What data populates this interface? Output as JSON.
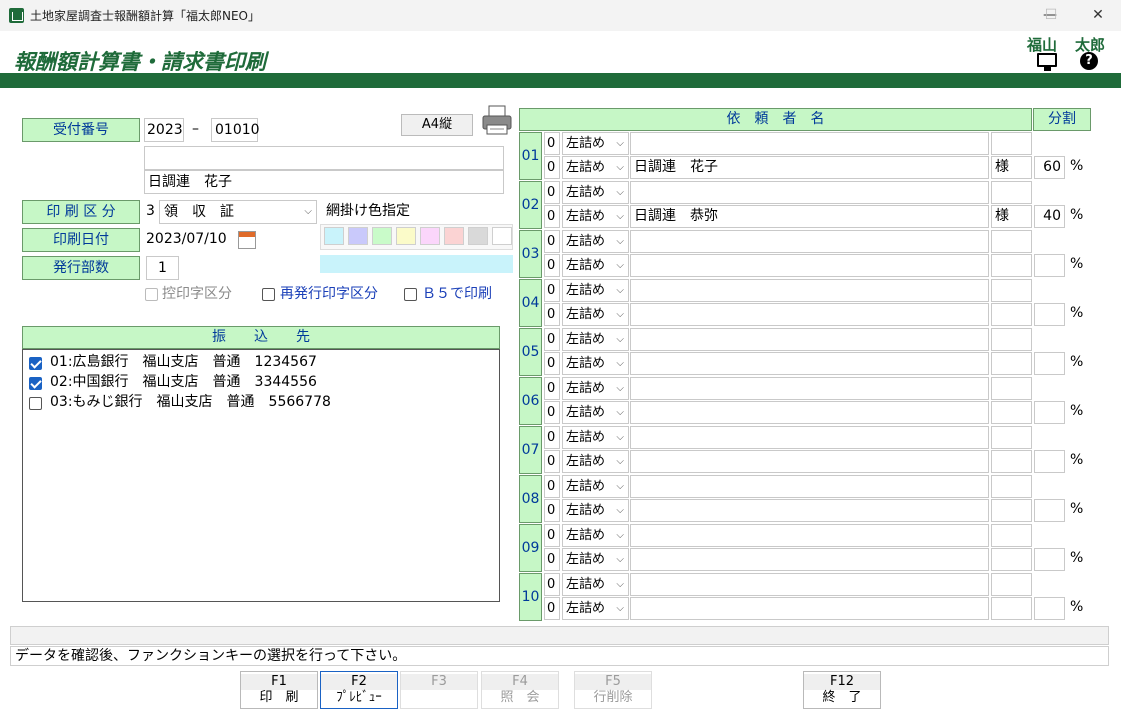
{
  "window": {
    "title": "土地家屋調査士報酬額計算「福太郎NEO」",
    "min": "—",
    "max": "☐",
    "close": "✕"
  },
  "header": {
    "title": "報酬額計算書・請求書印刷",
    "user_last": "福山",
    "user_first": "太郎",
    "help": "?"
  },
  "form": {
    "uketsuke_label": "受付番号",
    "uketsuke_year": "2023",
    "uketsuke_dash": "–",
    "uketsuke_no": "01010",
    "paper_size": "A4縦",
    "client_blank": "",
    "client_name": "日調連　花子",
    "print_kubun_label": "印 刷 区 分",
    "print_kubun_code": "3",
    "print_kubun_value": "領　収　証",
    "amikake_label": "網掛け色指定",
    "print_date_label": "印刷日付",
    "print_date": "2023/07/10",
    "copies_label": "発行部数",
    "copies": "1",
    "cb_hikae": "控印字区分",
    "cb_saihakko": "再発行印字区分",
    "cb_b5": "Ｂ５で印刷"
  },
  "swatch_colors": [
    "#c9f3fb",
    "#c9c9fb",
    "#c9fbc9",
    "#fbfbc9",
    "#fbd6fb",
    "#fbd3d3",
    "#d9d9d9",
    "#ffffff"
  ],
  "furikomi": {
    "header": "振　　込　　先",
    "items": [
      {
        "text": "01:広島銀行　福山支店　普通　1234567",
        "checked": true
      },
      {
        "text": "02:中国銀行　福山支店　普通　3344556",
        "checked": true
      },
      {
        "text": "03:もみじ銀行　福山支店　普通　5566778",
        "checked": false
      }
    ]
  },
  "grid": {
    "header_name": "依　頼　者　名",
    "header_split": "分割",
    "justify": "左詰め",
    "pct": "%",
    "rows": [
      {
        "no": "01",
        "a": {
          "code": "0",
          "name": "",
          "sama": "",
          "split": ""
        },
        "b": {
          "code": "0",
          "name": "日調連　花子",
          "sama": "様",
          "split": "60"
        }
      },
      {
        "no": "02",
        "a": {
          "code": "0",
          "name": "",
          "sama": "",
          "split": ""
        },
        "b": {
          "code": "0",
          "name": "日調連　恭弥",
          "sama": "様",
          "split": "40"
        }
      },
      {
        "no": "03",
        "a": {
          "code": "0",
          "name": "",
          "sama": "",
          "split": ""
        },
        "b": {
          "code": "0",
          "name": "",
          "sama": "",
          "split": ""
        }
      },
      {
        "no": "04",
        "a": {
          "code": "0",
          "name": "",
          "sama": "",
          "split": ""
        },
        "b": {
          "code": "0",
          "name": "",
          "sama": "",
          "split": ""
        }
      },
      {
        "no": "05",
        "a": {
          "code": "0",
          "name": "",
          "sama": "",
          "split": ""
        },
        "b": {
          "code": "0",
          "name": "",
          "sama": "",
          "split": ""
        }
      },
      {
        "no": "06",
        "a": {
          "code": "0",
          "name": "",
          "sama": "",
          "split": ""
        },
        "b": {
          "code": "0",
          "name": "",
          "sama": "",
          "split": ""
        }
      },
      {
        "no": "07",
        "a": {
          "code": "0",
          "name": "",
          "sama": "",
          "split": ""
        },
        "b": {
          "code": "0",
          "name": "",
          "sama": "",
          "split": ""
        }
      },
      {
        "no": "08",
        "a": {
          "code": "0",
          "name": "",
          "sama": "",
          "split": ""
        },
        "b": {
          "code": "0",
          "name": "",
          "sama": "",
          "split": ""
        }
      },
      {
        "no": "09",
        "a": {
          "code": "0",
          "name": "",
          "sama": "",
          "split": ""
        },
        "b": {
          "code": "0",
          "name": "",
          "sama": "",
          "split": ""
        }
      },
      {
        "no": "10",
        "a": {
          "code": "0",
          "name": "",
          "sama": "",
          "split": ""
        },
        "b": {
          "code": "0",
          "name": "",
          "sama": "",
          "split": ""
        }
      }
    ]
  },
  "status": {
    "top": "",
    "message": "データを確認後、ファンクションキーの選択を行って下さい。"
  },
  "fkeys": [
    {
      "key": "F1",
      "label": "印　刷",
      "state": "normal"
    },
    {
      "key": "F2",
      "label": "ﾌﾟﾚﾋﾞｭｰ",
      "state": "selected"
    },
    {
      "key": "F3",
      "label": "",
      "state": "disabled"
    },
    {
      "key": "F4",
      "label": "照　会",
      "state": "disabled"
    },
    {
      "key": "F5",
      "label": "行削除",
      "state": "disabled"
    },
    {
      "key": "F12",
      "label": "終　了",
      "state": "normal"
    }
  ]
}
